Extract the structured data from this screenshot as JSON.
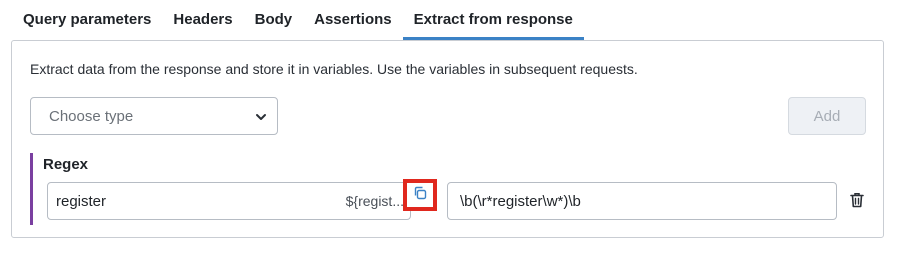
{
  "tabs": [
    {
      "label": "Query parameters",
      "active": false
    },
    {
      "label": "Headers",
      "active": false
    },
    {
      "label": "Body",
      "active": false
    },
    {
      "label": "Assertions",
      "active": false
    },
    {
      "label": "Extract from response",
      "active": true
    }
  ],
  "panel": {
    "description": "Extract data from the response and store it in variables. Use the variables in subsequent requests.",
    "type_select": {
      "placeholder": "Choose type",
      "icon": "chevron-down-icon"
    },
    "add_button": {
      "label": "Add",
      "disabled": true
    },
    "extraction": {
      "type_label": "Regex",
      "variable_name": "register",
      "variable_reference": "${regist...",
      "copy_icon": "copy-icon",
      "expression": "\\b(\\r*register\\w*)\\b",
      "delete_icon": "trash-icon"
    }
  },
  "colors": {
    "active_tab_underline": "#3b82c6",
    "extraction_accent": "#7a3fa0",
    "highlight_box": "#e0281e",
    "copy_icon": "#3b82c6"
  }
}
